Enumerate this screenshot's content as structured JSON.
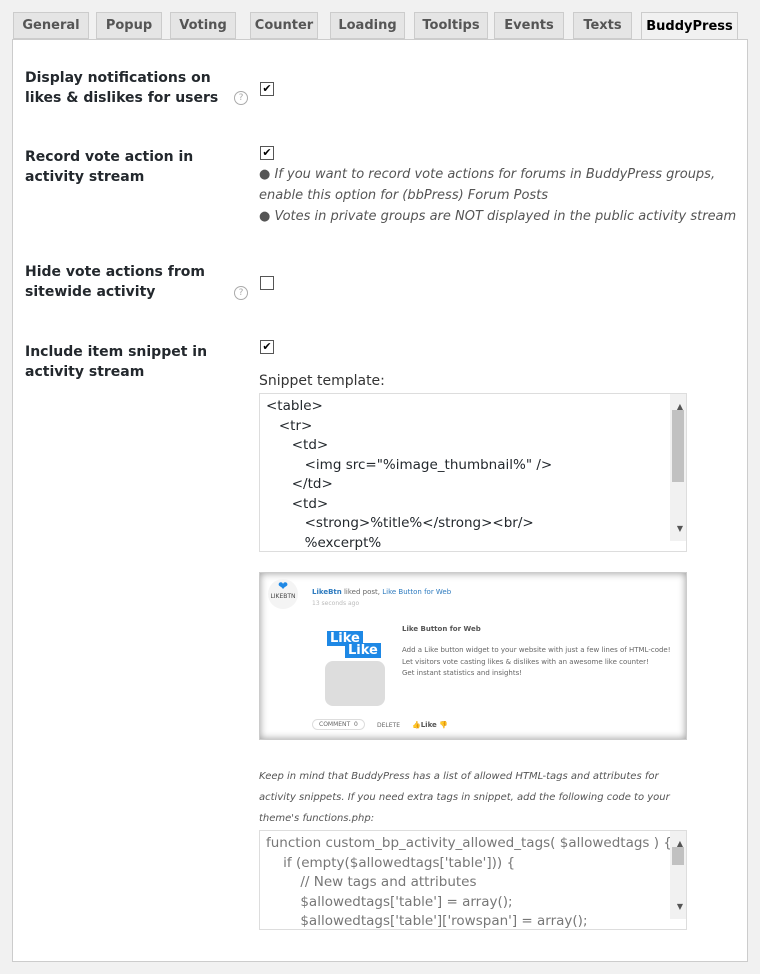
{
  "tabs": [
    "General",
    "Popup",
    "Voting",
    "Counter",
    "Loading",
    "Tooltips",
    "Events",
    "Texts",
    "BuddyPress"
  ],
  "active_tab": "BuddyPress",
  "settings": [
    {
      "label": "Display notifications on likes & dislikes for users",
      "checked": true,
      "help": "?"
    },
    {
      "label": "Record vote action in activity stream",
      "checked": true,
      "notes": [
        "● If you want to record vote actions for forums in BuddyPress groups, enable this option for (bbPress) Forum Posts",
        "● Votes in private groups are NOT displayed in the public activity stream"
      ]
    },
    {
      "label": "Hide vote actions from sitewide activity",
      "checked": false,
      "help": "?"
    },
    {
      "label": "Include item snippet in activity stream",
      "checked": true
    }
  ],
  "snippet": {
    "label": "Snippet template:",
    "value": "<table>\n   <tr>\n      <td>\n         <img src=\"%image_thumbnail%\" />\n      </td>\n      <td>\n         <strong>%title%</strong><br/>\n         %excerpt%"
  },
  "preview": {
    "user": "LikeBtn",
    "action": " liked post, ",
    "post_link": "Like Button for Web",
    "time": "13 seconds ago",
    "logo_text": "LIKEBTN",
    "title": "Like Button for Web",
    "lines": [
      "Add a Like button widget to your website with just a few lines of HTML-code!",
      "Let visitors vote casting likes & dislikes with an awesome like counter!",
      "Get instant statistics and insights!"
    ],
    "comment": "COMMENT",
    "comment_count": "0",
    "delete": "DELETE",
    "like": "Like",
    "image_word": "Like"
  },
  "keep_note": "Keep in mind that BuddyPress has a list of allowed HTML-tags and attributes for activity snippets. If you need extra tags in snippet, add the following code to your theme's functions.php:",
  "code": "function custom_bp_activity_allowed_tags( $allowedtags ) {\n    if (empty($allowedtags['table'])) {\n        // New tags and attributes\n        $allowedtags['table'] = array();\n        $allowedtags['table']['rowspan'] = array();",
  "colors": {
    "link": "#2e7bbf",
    "accent": "#1e88e5"
  }
}
